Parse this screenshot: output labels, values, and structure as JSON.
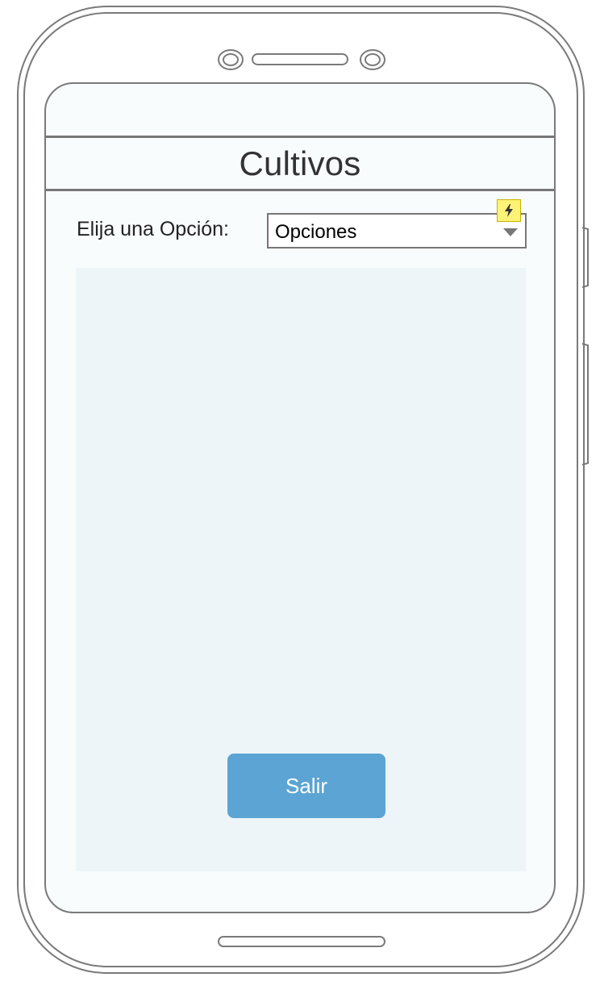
{
  "header": {
    "title": "Cultivos"
  },
  "form": {
    "option_label": "Elija una Opción:",
    "select_value": "Opciones"
  },
  "actions": {
    "exit_label": "Salir"
  },
  "icons": {
    "select_arrow": "chevron-down-icon",
    "flash": "lightning-icon"
  },
  "colors": {
    "screen_background": "#f8fcfd",
    "panel_background": "#edf5f9",
    "button_background": "#5ba4d3",
    "flash_badge": "#fff377",
    "outline": "#777777"
  }
}
